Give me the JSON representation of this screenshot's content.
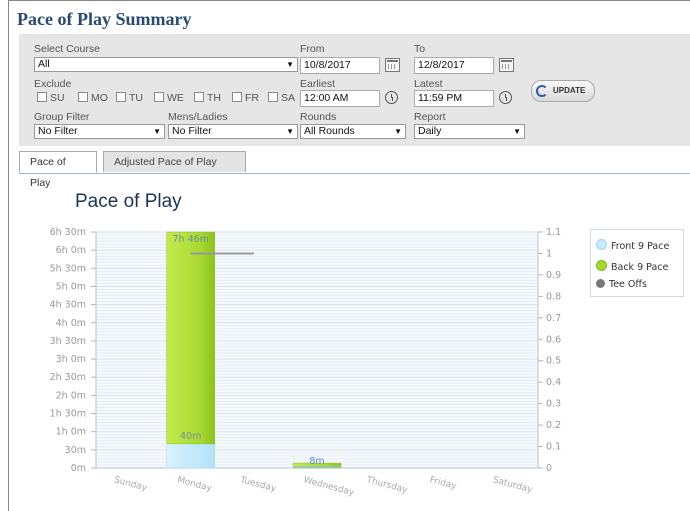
{
  "page": {
    "title": "Pace of Play Summary"
  },
  "filters": {
    "course_label": "Select Course",
    "course_value": "All",
    "from_label": "From",
    "from_value": "10/8/2017",
    "to_label": "To",
    "to_value": "12/8/2017",
    "exclude_label": "Exclude",
    "days": [
      "SU",
      "MO",
      "TU",
      "WE",
      "TH",
      "FR",
      "SA"
    ],
    "earliest_label": "Earliest",
    "earliest_value": "12:00 AM",
    "latest_label": "Latest",
    "latest_value": "11:59 PM",
    "update_label": "UPDATE",
    "group_label": "Group Filter",
    "group_value": "No Filter",
    "mens_label": "Mens/Ladies",
    "mens_value": "No Filter",
    "rounds_label": "Rounds",
    "rounds_value": "All Rounds",
    "report_label": "Report",
    "report_value": "Daily"
  },
  "tabs": [
    {
      "label": "Pace of Play"
    },
    {
      "label": "Adjusted Pace of Play"
    }
  ],
  "chart_data": {
    "type": "bar",
    "title": "Pace of Play",
    "categories": [
      "Sunday",
      "Monday",
      "Tuesday",
      "Wednesday",
      "Thursday",
      "Friday",
      "Saturday"
    ],
    "series": [
      {
        "name": "Front 9 Pace",
        "stack": true,
        "values": [
          0,
          40,
          0,
          0,
          0,
          0,
          0
        ],
        "color": "#c6ecfa",
        "unit": "minutes"
      },
      {
        "name": "Back 9 Pace",
        "stack": true,
        "values": [
          0,
          426,
          0,
          8,
          0,
          0,
          0
        ],
        "color": "#a7d930",
        "unit": "minutes"
      },
      {
        "name": "Tee Offs",
        "type": "line",
        "axis": "right",
        "values": [
          null,
          1,
          1,
          null,
          null,
          null,
          null
        ],
        "color": "#999999"
      }
    ],
    "data_labels": [
      {
        "category": "Monday",
        "text": "7h 46m"
      },
      {
        "category": "Monday",
        "text": "40m"
      },
      {
        "category": "Wednesday",
        "text": "8m"
      }
    ],
    "y_left_ticks": [
      "0m",
      "30m",
      "1h 0m",
      "1h 30m",
      "2h 0m",
      "2h 30m",
      "3h 0m",
      "3h 30m",
      "4h 0m",
      "4h 30m",
      "5h 0m",
      "5h 30m",
      "6h 0m",
      "6h 30m"
    ],
    "y_right_ticks": [
      "0",
      "0.1",
      "0.2",
      "0.3",
      "0.4",
      "0.5",
      "0.6",
      "0.7",
      "0.8",
      "0.9",
      "1",
      "1.1"
    ],
    "ylim_left_minutes": [
      0,
      390
    ],
    "ylim_right": [
      0,
      1.1
    ],
    "legend": "right",
    "grid": true
  }
}
